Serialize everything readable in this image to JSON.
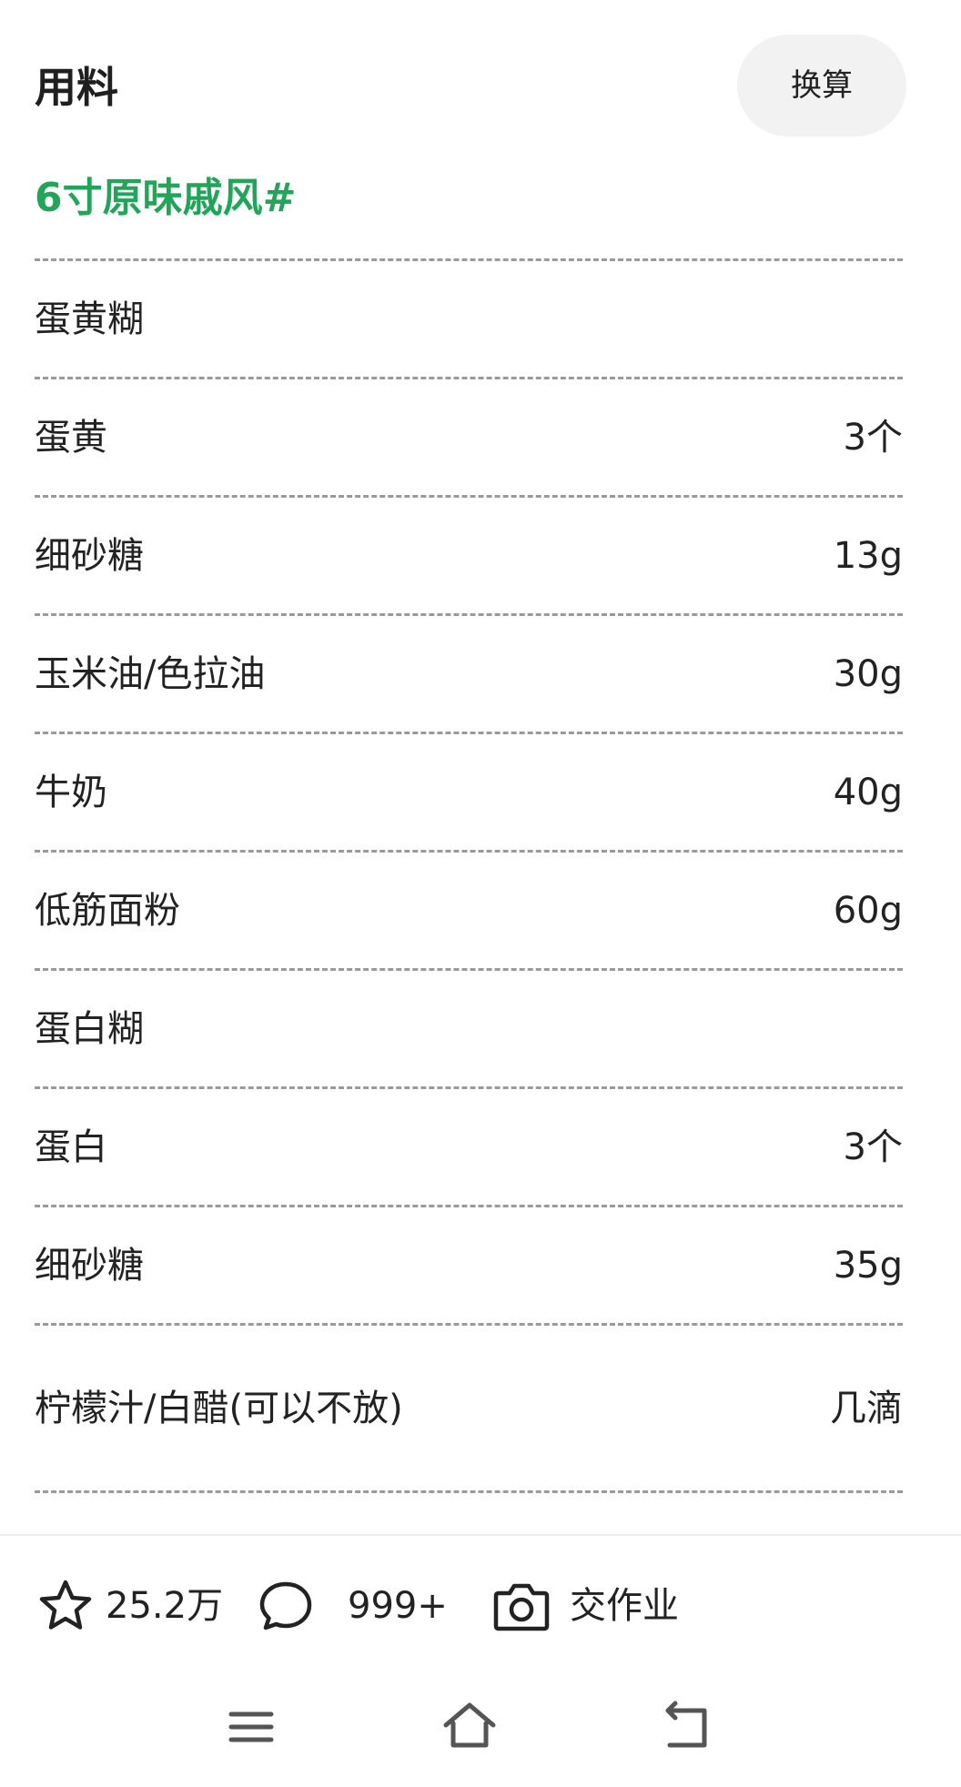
{
  "header": {
    "title": "用料",
    "convert_label": "换算"
  },
  "recipe": {
    "name": "6寸原味戚风#"
  },
  "ingredients": [
    {
      "name": "蛋黄糊",
      "amount": ""
    },
    {
      "name": "蛋黄",
      "amount": "3个"
    },
    {
      "name": "细砂糖",
      "amount": "13g"
    },
    {
      "name": "玉米油/色拉油",
      "amount": "30g"
    },
    {
      "name": "牛奶",
      "amount": "40g"
    },
    {
      "name": "低筋面粉",
      "amount": "60g"
    },
    {
      "name": "蛋白糊",
      "amount": ""
    },
    {
      "name": "蛋白",
      "amount": "3个"
    },
    {
      "name": "细砂糖",
      "amount": "35g"
    },
    {
      "name": "柠檬汁/白醋(可以不放)",
      "amount": "几滴"
    }
  ],
  "actions": {
    "favorite_count": "25.2万",
    "comment_count": "999+",
    "homework_label": "交作业"
  },
  "icons": {
    "favorite": "star-icon",
    "comment": "comment-bubble-icon",
    "homework": "camera-icon",
    "nav_menu": "menu-icon",
    "nav_home": "home-icon",
    "nav_back": "back-icon"
  },
  "colors": {
    "accent": "#22a55a",
    "button_bg": "#f2f2f2",
    "divider": "#9a9a9a"
  }
}
